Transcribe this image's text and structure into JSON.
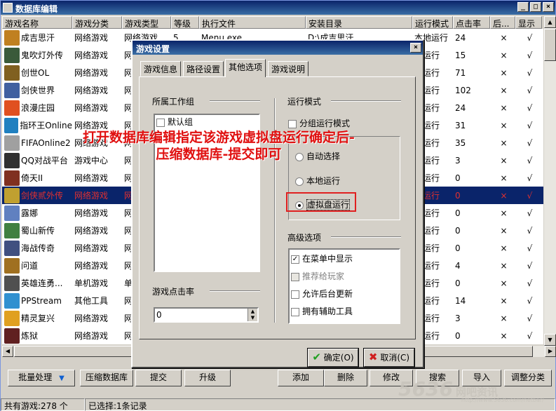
{
  "window": {
    "title": "数据库编辑"
  },
  "columns": [
    "游戏名称",
    "游戏分类",
    "游戏类型",
    "等级",
    "执行文件",
    "安装目录",
    "运行模式",
    "点击率",
    "后...",
    "显示"
  ],
  "rows": [
    {
      "name": "成吉思汗",
      "cat": "网络游戏",
      "type": "网络游戏",
      "level": "5",
      "exe": "Menu.exe",
      "dir": "D:\\成吉思汗",
      "mode": "本地运行",
      "clicks": "24",
      "bg": "×",
      "show": "√",
      "color": "#c08020"
    },
    {
      "name": "鬼吹灯外传",
      "cat": "网络游戏",
      "type": "网",
      "level": "",
      "exe": "",
      "dir": "",
      "mode": "地运行",
      "clicks": "15",
      "bg": "×",
      "show": "√",
      "color": "#3a5a3a"
    },
    {
      "name": "创世OL",
      "cat": "网络游戏",
      "type": "网",
      "level": "",
      "exe": "",
      "dir": "",
      "mode": "地运行",
      "clicks": "71",
      "bg": "×",
      "show": "√",
      "color": "#806020"
    },
    {
      "name": "剑侠世界",
      "cat": "网络游戏",
      "type": "网",
      "level": "",
      "exe": "",
      "dir": "",
      "mode": "地运行",
      "clicks": "102",
      "bg": "×",
      "show": "√",
      "color": "#4060a0"
    },
    {
      "name": "浪漫庄园",
      "cat": "网络游戏",
      "type": "网",
      "level": "",
      "exe": "",
      "dir": "",
      "mode": "地运行",
      "clicks": "24",
      "bg": "×",
      "show": "√",
      "color": "#e05020"
    },
    {
      "name": "指环王Online",
      "cat": "网络游戏",
      "type": "网",
      "level": "",
      "exe": "",
      "dir": "",
      "mode": "地运行",
      "clicks": "31",
      "bg": "×",
      "show": "√",
      "color": "#2080c0"
    },
    {
      "name": "FIFAOnline2",
      "cat": "网络游戏",
      "type": "网",
      "level": "",
      "exe": "",
      "dir": "",
      "mode": "地运行",
      "clicks": "35",
      "bg": "×",
      "show": "√",
      "color": "#a0a0a0"
    },
    {
      "name": "QQ对战平台",
      "cat": "游戏中心",
      "type": "网",
      "level": "",
      "exe": "",
      "dir": "",
      "mode": "地运行",
      "clicks": "3",
      "bg": "×",
      "show": "√",
      "color": "#303030"
    },
    {
      "name": "倚天II",
      "cat": "网络游戏",
      "type": "网",
      "level": "",
      "exe": "",
      "dir": "",
      "mode": "地运行",
      "clicks": "0",
      "bg": "×",
      "show": "√",
      "color": "#803020"
    },
    {
      "name": "剑侠贰外传",
      "cat": "网络游戏",
      "type": "网",
      "level": "",
      "exe": "",
      "dir": "",
      "mode": "地运行",
      "clicks": "0",
      "bg": "×",
      "show": "√",
      "color": "#c0a030",
      "selected": true
    },
    {
      "name": "露娜",
      "cat": "网络游戏",
      "type": "网",
      "level": "",
      "exe": "",
      "dir": "",
      "mode": "地运行",
      "clicks": "0",
      "bg": "×",
      "show": "√",
      "color": "#6080c0"
    },
    {
      "name": "蜀山新传",
      "cat": "网络游戏",
      "type": "网",
      "level": "",
      "exe": "",
      "dir": "",
      "mode": "地运行",
      "clicks": "0",
      "bg": "×",
      "show": "√",
      "color": "#408040"
    },
    {
      "name": "海战传奇",
      "cat": "网络游戏",
      "type": "网",
      "level": "",
      "exe": "",
      "dir": "",
      "mode": "地运行",
      "clicks": "0",
      "bg": "×",
      "show": "√",
      "color": "#405080"
    },
    {
      "name": "问道",
      "cat": "网络游戏",
      "type": "网",
      "level": "",
      "exe": "",
      "dir": "",
      "mode": "地运行",
      "clicks": "4",
      "bg": "×",
      "show": "√",
      "color": "#a07020"
    },
    {
      "name": "英雄连勇...",
      "cat": "单机游戏",
      "type": "单",
      "level": "",
      "exe": "",
      "dir": "",
      "mode": "地运行",
      "clicks": "0",
      "bg": "×",
      "show": "√",
      "color": "#505050"
    },
    {
      "name": "PPStream",
      "cat": "其他工具",
      "type": "网",
      "level": "",
      "exe": "",
      "dir": "",
      "mode": "地运行",
      "clicks": "14",
      "bg": "×",
      "show": "√",
      "color": "#3090d0"
    },
    {
      "name": "精灵复兴",
      "cat": "网络游戏",
      "type": "网",
      "level": "",
      "exe": "",
      "dir": "",
      "mode": "地运行",
      "clicks": "3",
      "bg": "×",
      "show": "√",
      "color": "#e0a020"
    },
    {
      "name": "炼狱",
      "cat": "网络游戏",
      "type": "网",
      "level": "",
      "exe": "",
      "dir": "",
      "mode": "地运行",
      "clicks": "0",
      "bg": "×",
      "show": "√",
      "color": "#602020"
    }
  ],
  "toolbar": {
    "batch": "批量处理",
    "compress": "压缩数据库",
    "submit": "提交",
    "upgrade": "升级",
    "add": "添加",
    "delete": "删除",
    "modify": "修改",
    "search": "搜索",
    "import": "导入",
    "adjust": "调整分类"
  },
  "status": {
    "total": "共有游戏:278 个",
    "selected": "已选择:1条记录"
  },
  "dialog": {
    "title": "游戏设置",
    "close": "×",
    "tabs": [
      "游戏信息",
      "路径设置",
      "其他选项",
      "游戏说明"
    ],
    "active_tab": 2,
    "workgroup_label": "所属工作组",
    "workgroups": [
      {
        "label": "默认组",
        "checked": false
      }
    ],
    "run_mode_label": "运行模式",
    "group_run_mode": "分组运行模式",
    "run_options": [
      {
        "label": "自动选择",
        "selected": false
      },
      {
        "label": "本地运行",
        "selected": false
      },
      {
        "label": "虚拟盘运行",
        "selected": true
      }
    ],
    "advanced_label": "高级选项",
    "advanced": [
      {
        "label": "在菜单中显示",
        "checked": true,
        "disabled": false
      },
      {
        "label": "推荐给玩家",
        "checked": false,
        "disabled": true
      },
      {
        "label": "允许后台更新",
        "checked": false,
        "disabled": false
      },
      {
        "label": "拥有辅助工具",
        "checked": false,
        "disabled": false
      }
    ],
    "clicks_label": "游戏点击率",
    "clicks_value": "0",
    "ok": "确定(O)",
    "cancel": "取消(C)"
  },
  "annotation": {
    "line1": "打开数据库编辑指定该游戏虚拟盘运行确定后-",
    "line2": "压缩数据库-提交即可"
  },
  "watermark": {
    "big": "5636",
    "cn": "网吧资讯",
    "url": "http://www.5636.com/netbar/"
  },
  "colors": {
    "title_bar": "#0a246a",
    "selection": "#0a246a",
    "annotation": "#e01010",
    "ok_icon": "#20a020",
    "cancel_icon": "#d02020"
  }
}
